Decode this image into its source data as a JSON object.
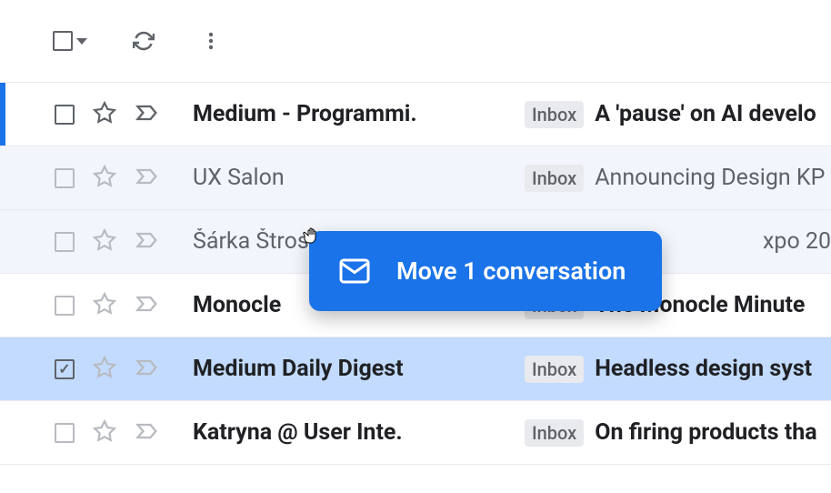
{
  "toolbar": {
    "select_all": "select-all",
    "refresh": "refresh",
    "more": "more"
  },
  "drag": {
    "text": "Move 1 conversation"
  },
  "emails": [
    {
      "sender": "Medium - Programmi.",
      "label": "Inbox",
      "subject": "A 'pause' on AI develo",
      "unread": true,
      "highlighted": true,
      "checked": false,
      "selected": false
    },
    {
      "sender": "UX Salon",
      "label": "Inbox",
      "subject": "Announcing Design KP",
      "unread": false,
      "highlighted": false,
      "checked": false,
      "selected": false
    },
    {
      "sender": "Šárka Štros",
      "label": "",
      "subject": "xpo 20",
      "unread": false,
      "highlighted": false,
      "checked": false,
      "selected": false
    },
    {
      "sender": "Monocle",
      "label": "Inbox",
      "subject": "The Monocle Minute ",
      "unread": true,
      "highlighted": false,
      "checked": false,
      "selected": false
    },
    {
      "sender": "Medium Daily Digest",
      "label": "Inbox",
      "subject": "Headless design syst",
      "unread": true,
      "highlighted": false,
      "checked": true,
      "selected": true
    },
    {
      "sender": "Katryna @ User Inte.",
      "label": "Inbox",
      "subject": "On firing products tha",
      "unread": true,
      "highlighted": false,
      "checked": false,
      "selected": false
    }
  ]
}
